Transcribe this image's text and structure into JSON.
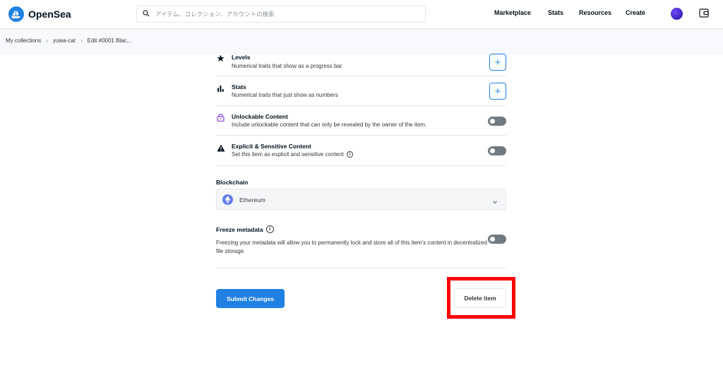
{
  "header": {
    "brand": "OpenSea",
    "search_placeholder": "アイテム、コレクション、アカウントの検索",
    "nav": [
      "Marketplace",
      "Stats",
      "Resources",
      "Create"
    ]
  },
  "breadcrumb": [
    "My collections",
    "yuwa-cat",
    "Edit #0001 Blac..."
  ],
  "properties": {
    "levels": {
      "title": "Levels",
      "desc": "Numerical traits that show as a progress bar"
    },
    "stats": {
      "title": "Stats",
      "desc": "Numerical traits that just show as numbers"
    },
    "unlockable": {
      "title": "Unlockable Content",
      "desc": "Include unlockable content that can only be revealed by the owner of the item.",
      "enabled": false
    },
    "explicit": {
      "title": "Explicit & Sensitive Content",
      "desc": "Set this item as explicit and sensitive content",
      "enabled": false
    }
  },
  "blockchain": {
    "label": "Blockchain",
    "selected": "Ethereum"
  },
  "freeze": {
    "title": "Freeze metadata",
    "desc": "Freezing your metadata will allow you to permanently lock and store all of this item's content in decentralized file storage.",
    "enabled": false
  },
  "actions": {
    "submit": "Submit Changes",
    "delete": "Delete item"
  },
  "colors": {
    "primary": "#2081e2",
    "highlight": "#ff0000",
    "toggle_off": "#707a83"
  }
}
